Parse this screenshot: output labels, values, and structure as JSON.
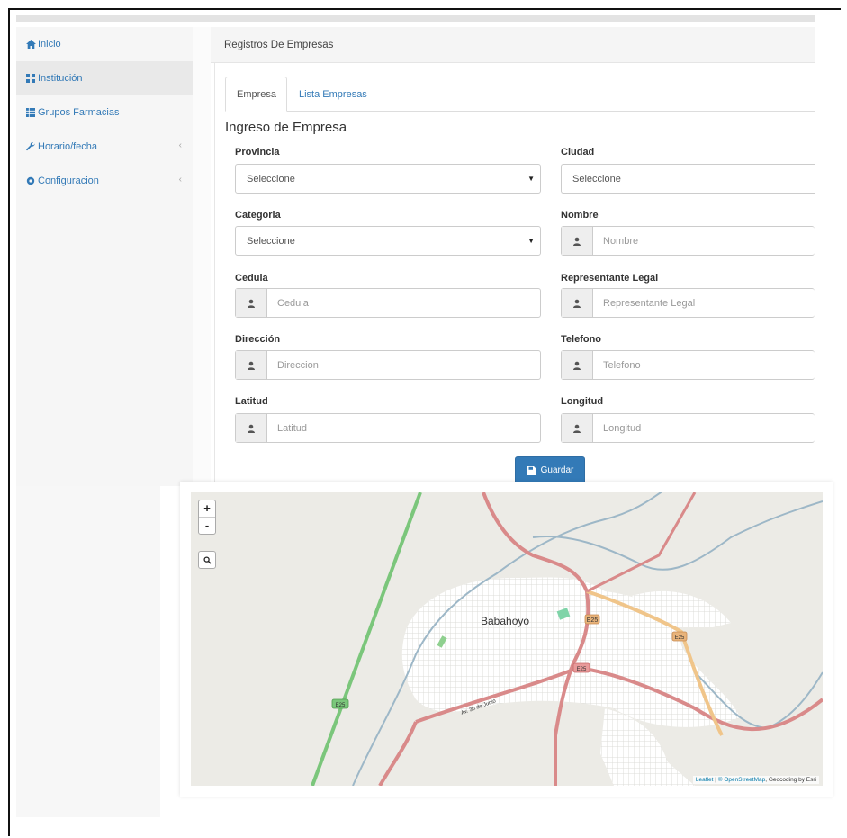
{
  "sidebar": {
    "items": [
      {
        "label": "Inicio",
        "icon": "home-icon"
      },
      {
        "label": "Institución",
        "icon": "grid-icon"
      },
      {
        "label": "Grupos Farmacias",
        "icon": "table-icon"
      },
      {
        "label": "Horario/fecha",
        "icon": "wrench-icon"
      },
      {
        "label": "Configuracion",
        "icon": "gear-icon"
      }
    ]
  },
  "header": {
    "title": "Registros De Empresas"
  },
  "tabs": [
    {
      "label": "Empresa",
      "active": true
    },
    {
      "label": "Lista Empresas",
      "active": false
    }
  ],
  "form": {
    "title": "Ingreso de Empresa",
    "provincia": {
      "label": "Provincia",
      "value": "Seleccione"
    },
    "ciudad": {
      "label": "Ciudad",
      "value": "Seleccione"
    },
    "categoria": {
      "label": "Categoria",
      "value": "Seleccione"
    },
    "nombre": {
      "label": "Nombre",
      "placeholder": "Nombre"
    },
    "cedula": {
      "label": "Cedula",
      "placeholder": "Cedula"
    },
    "representante": {
      "label": "Representante Legal",
      "placeholder": "Representante Legal"
    },
    "direccion": {
      "label": "Dirección",
      "placeholder": "Direccion"
    },
    "telefono": {
      "label": "Telefono",
      "placeholder": "Telefono"
    },
    "latitud": {
      "label": "Latitud",
      "placeholder": "Latitud"
    },
    "longitud": {
      "label": "Longitud",
      "placeholder": "Longitud"
    },
    "save_label": "Guardar"
  },
  "map": {
    "zoom_in": "+",
    "zoom_out": "-",
    "city": "Babahoyo",
    "attribution_leaflet": "Leaflet",
    "attribution_osm": "© OpenStreetMap",
    "attribution_geocoding": "Geocoding by Esri",
    "road_labels": [
      "E25",
      "E25",
      "E25",
      "E25",
      "Av. 30 de Junio"
    ]
  },
  "colors": {
    "accent": "#337ab7",
    "road_red": "#d98a8a",
    "road_green": "#7bc67b",
    "river": "#9db7c7",
    "road_orange": "#f0c58a"
  }
}
